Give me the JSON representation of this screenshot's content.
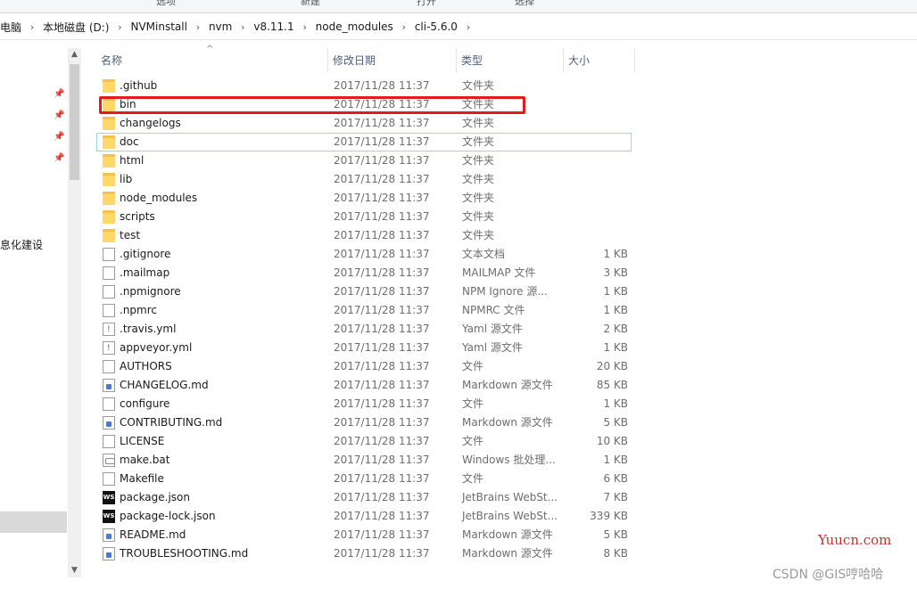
{
  "ribbon": {
    "labels": [
      "选项",
      "新建",
      "打开",
      "选择"
    ]
  },
  "breadcrumb": {
    "items": [
      "电脑",
      "本地磁盘 (D:)",
      "NVMinstall",
      "nvm",
      "v8.11.1",
      "node_modules",
      "cli-5.6.0"
    ]
  },
  "nav": {
    "text": "息化建设"
  },
  "columns": {
    "name": "名称",
    "date": "修改日期",
    "type": "类型",
    "size": "大小"
  },
  "files": [
    {
      "name": ".github",
      "date": "2017/11/28 11:37",
      "type": "文件夹",
      "size": "",
      "icon": "folder-icon"
    },
    {
      "name": "bin",
      "date": "2017/11/28 11:37",
      "type": "文件夹",
      "size": "",
      "icon": "folder-icon"
    },
    {
      "name": "changelogs",
      "date": "2017/11/28 11:37",
      "type": "文件夹",
      "size": "",
      "icon": "folder-icon"
    },
    {
      "name": "doc",
      "date": "2017/11/28 11:37",
      "type": "文件夹",
      "size": "",
      "icon": "folder-icon"
    },
    {
      "name": "html",
      "date": "2017/11/28 11:37",
      "type": "文件夹",
      "size": "",
      "icon": "folder-icon"
    },
    {
      "name": "lib",
      "date": "2017/11/28 11:37",
      "type": "文件夹",
      "size": "",
      "icon": "folder-icon"
    },
    {
      "name": "node_modules",
      "date": "2017/11/28 11:37",
      "type": "文件夹",
      "size": "",
      "icon": "folder-icon"
    },
    {
      "name": "scripts",
      "date": "2017/11/28 11:37",
      "type": "文件夹",
      "size": "",
      "icon": "folder-icon"
    },
    {
      "name": "test",
      "date": "2017/11/28 11:37",
      "type": "文件夹",
      "size": "",
      "icon": "folder-icon"
    },
    {
      "name": ".gitignore",
      "date": "2017/11/28 11:37",
      "type": "文本文档",
      "size": "1 KB",
      "icon": "text-file-icon"
    },
    {
      "name": ".mailmap",
      "date": "2017/11/28 11:37",
      "type": "MAILMAP 文件",
      "size": "3 KB",
      "icon": "file-icon"
    },
    {
      "name": ".npmignore",
      "date": "2017/11/28 11:37",
      "type": "NPM Ignore 源...",
      "size": "1 KB",
      "icon": "text-file-icon"
    },
    {
      "name": ".npmrc",
      "date": "2017/11/28 11:37",
      "type": "NPMRC 文件",
      "size": "1 KB",
      "icon": "file-icon"
    },
    {
      "name": ".travis.yml",
      "date": "2017/11/28 11:37",
      "type": "Yaml 源文件",
      "size": "2 KB",
      "icon": "yaml-file-icon"
    },
    {
      "name": "appveyor.yml",
      "date": "2017/11/28 11:37",
      "type": "Yaml 源文件",
      "size": "1 KB",
      "icon": "yaml-file-icon"
    },
    {
      "name": "AUTHORS",
      "date": "2017/11/28 11:37",
      "type": "文件",
      "size": "20 KB",
      "icon": "file-icon"
    },
    {
      "name": "CHANGELOG.md",
      "date": "2017/11/28 11:37",
      "type": "Markdown 源文件",
      "size": "85 KB",
      "icon": "markdown-file-icon"
    },
    {
      "name": "configure",
      "date": "2017/11/28 11:37",
      "type": "文件",
      "size": "1 KB",
      "icon": "file-icon"
    },
    {
      "name": "CONTRIBUTING.md",
      "date": "2017/11/28 11:37",
      "type": "Markdown 源文件",
      "size": "5 KB",
      "icon": "markdown-file-icon"
    },
    {
      "name": "LICENSE",
      "date": "2017/11/28 11:37",
      "type": "文件",
      "size": "10 KB",
      "icon": "file-icon"
    },
    {
      "name": "make.bat",
      "date": "2017/11/28 11:37",
      "type": "Windows 批处理...",
      "size": "1 KB",
      "icon": "batch-file-icon"
    },
    {
      "name": "Makefile",
      "date": "2017/11/28 11:37",
      "type": "文件",
      "size": "6 KB",
      "icon": "file-icon"
    },
    {
      "name": "package.json",
      "date": "2017/11/28 11:37",
      "type": "JetBrains WebSt...",
      "size": "7 KB",
      "icon": "webstorm-file-icon"
    },
    {
      "name": "package-lock.json",
      "date": "2017/11/28 11:37",
      "type": "JetBrains WebSt...",
      "size": "339 KB",
      "icon": "webstorm-file-icon"
    },
    {
      "name": "README.md",
      "date": "2017/11/28 11:37",
      "type": "Markdown 源文件",
      "size": "5 KB",
      "icon": "markdown-file-icon"
    },
    {
      "name": "TROUBLESHOOTING.md",
      "date": "2017/11/28 11:37",
      "type": "Markdown 源文件",
      "size": "8 KB",
      "icon": "markdown-file-icon"
    }
  ],
  "watermarks": {
    "site": "Yuucn.com",
    "author": "CSDN @GIS哼哈哈"
  },
  "colors": {
    "highlight": "#e21b1b",
    "folder": "#ffd869",
    "watermark_site": "#c03328"
  }
}
